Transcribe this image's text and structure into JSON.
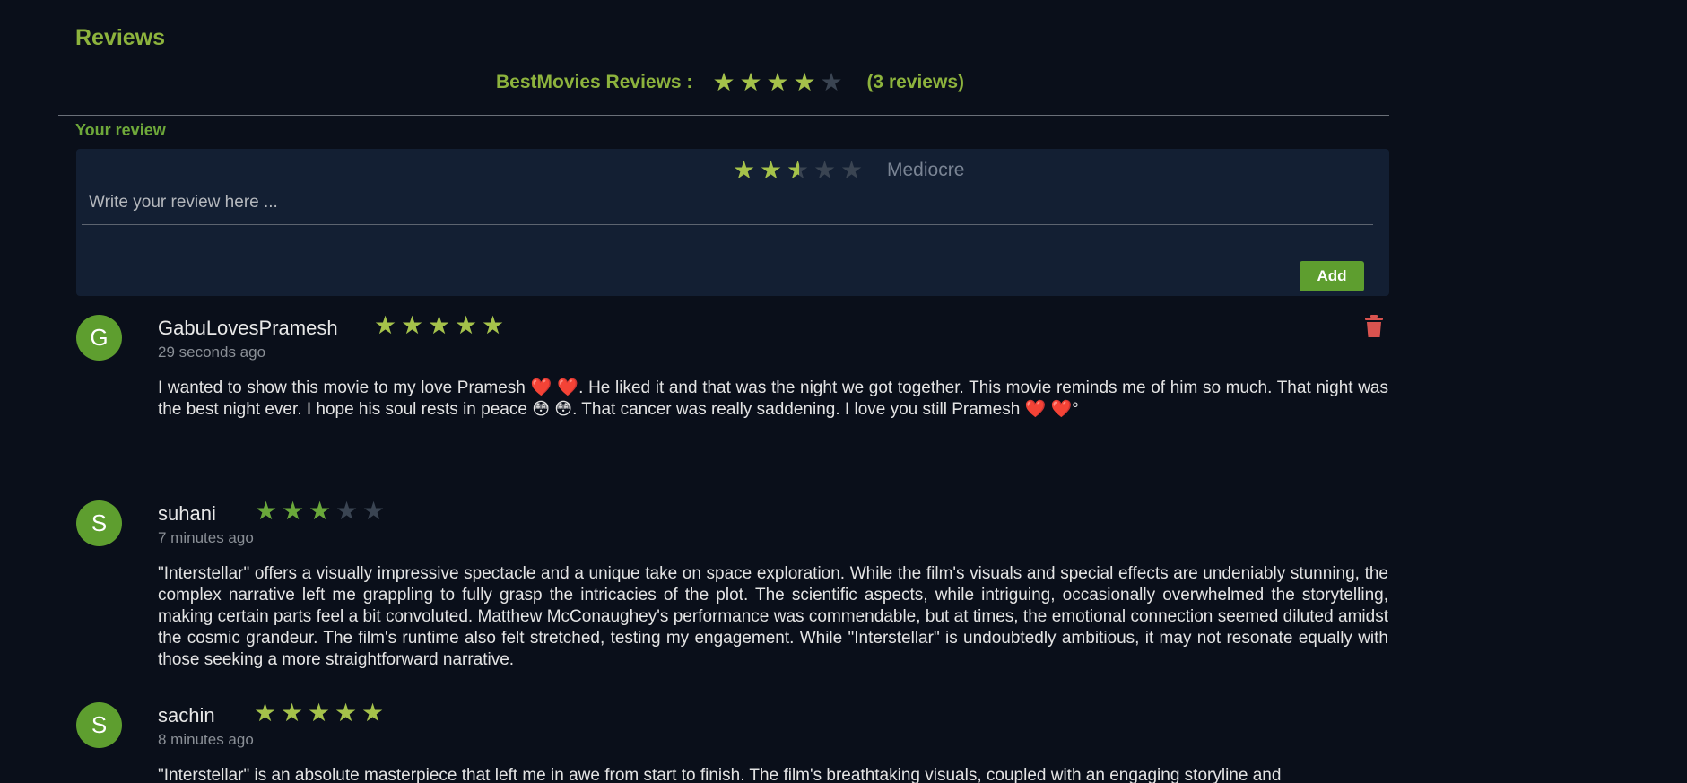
{
  "section_title": "Reviews",
  "summary": {
    "site_label": "BestMovies Reviews :",
    "rating": 3.9,
    "max_rating": 5,
    "count_text": "(3 reviews)"
  },
  "your_review": {
    "label": "Your review",
    "rating": 2.5,
    "rating_label": "Mediocre",
    "placeholder": "Write your review here ...",
    "add_label": "Add"
  },
  "colors": {
    "accent": "#8db33d",
    "accent_dark": "#5e9e2f",
    "star_empty": "#3a4452",
    "star_filled": "#a5c24a",
    "star_filled_review": "#6aa83a",
    "delete": "#d9534f",
    "background": "#0a0f1a",
    "panel": "#131f33"
  },
  "reviews": [
    {
      "avatar_letter": "G",
      "author": "GabuLovesPramesh",
      "rating": 5,
      "time": "29 seconds ago",
      "text": "I wanted to show this movie to my love Pramesh ❤️ ❤️. He liked it and that was the night we got together. This movie reminds me of him so much. That night was the best night ever. I hope his soul rests in peace 😳 😳. That cancer was really saddening. I love you still Pramesh ❤️ ❤️°",
      "deletable": true,
      "delete_icon": "trash-icon"
    },
    {
      "avatar_letter": "S",
      "author": "suhani",
      "rating": 3,
      "time": "7 minutes ago",
      "text": "\"Interstellar\" offers a visually impressive spectacle and a unique take on space exploration. While the film's visuals and special effects are undeniably stunning, the complex narrative left me grappling to fully grasp the intricacies of the plot. The scientific aspects, while intriguing, occasionally overwhelmed the storytelling, making certain parts feel a bit convoluted. Matthew McConaughey's performance was commendable, but at times, the emotional connection seemed diluted amidst the cosmic grandeur. The film's runtime also felt stretched, testing my engagement. While \"Interstellar\" is undoubtedly ambitious, it may not resonate equally with those seeking a more straightforward narrative.",
      "deletable": false
    },
    {
      "avatar_letter": "S",
      "author": "sachin",
      "rating": 5,
      "time": "8 minutes ago",
      "text": "\"Interstellar\" is an absolute masterpiece that left me in awe from start to finish. The film's breathtaking visuals, coupled with an engaging storyline and",
      "deletable": false
    }
  ]
}
